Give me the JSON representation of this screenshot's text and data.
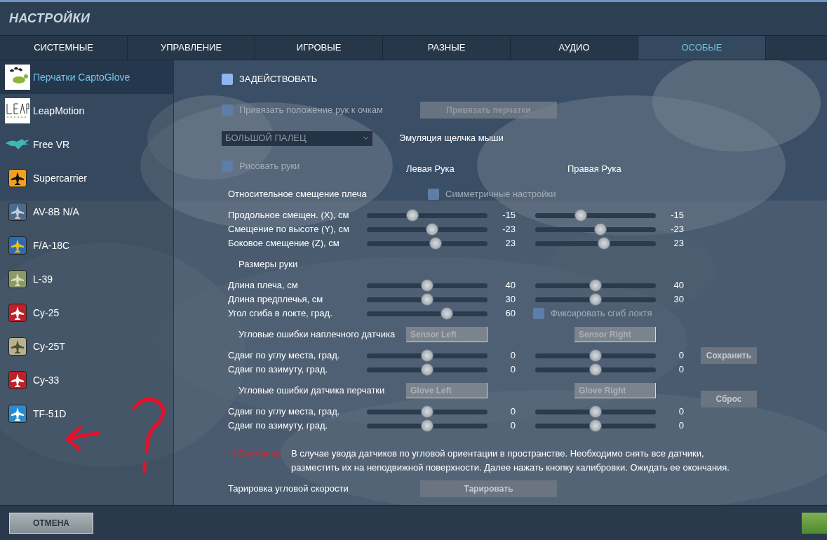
{
  "window": {
    "title": "НАСТРОЙКИ"
  },
  "tabs": [
    {
      "label": "СИСТЕМНЫЕ",
      "selected": false
    },
    {
      "label": "УПРАВЛЕНИЕ",
      "selected": false
    },
    {
      "label": "ИГРОВЫЕ",
      "selected": false
    },
    {
      "label": "РАЗНЫЕ",
      "selected": false
    },
    {
      "label": "АУДИО",
      "selected": false
    },
    {
      "label": "ОСОБЫЕ",
      "selected": true
    }
  ],
  "sidebar": {
    "items": [
      {
        "label": "Перчатки CaptoGlove",
        "selected": true
      },
      {
        "label": "LeapMotion",
        "selected": false
      },
      {
        "label": "Free VR",
        "selected": false
      },
      {
        "label": "Supercarrier",
        "selected": false
      },
      {
        "label": "AV-8B N/A",
        "selected": false
      },
      {
        "label": "F/A-18C",
        "selected": false
      },
      {
        "label": "L-39",
        "selected": false
      },
      {
        "label": "Су-25",
        "selected": false
      },
      {
        "label": "Су-25Т",
        "selected": false
      },
      {
        "label": "Су-33",
        "selected": false
      },
      {
        "label": "TF-51D",
        "selected": false
      }
    ]
  },
  "enable": {
    "label": "ЗАДЕЙСТВОВАТЬ",
    "checked": false,
    "disabled": false
  },
  "attach": {
    "label": "Привязать положение рук к очкам",
    "checked": false,
    "disabled": true,
    "button": "Привязать перчатки"
  },
  "finger": {
    "value": "БОЛЬШОЙ ПАЛЕЦ",
    "label": "Эмуляция щелчка мыши"
  },
  "draw_hands": {
    "label": "Рисовать руки",
    "checked": false,
    "disabled": true
  },
  "left_hand": "Левая Рука",
  "right_hand": "Правая Рука",
  "shoulder": {
    "label": "Относительное смещение плеча",
    "symmetric": {
      "label": "Симметричные настройки",
      "checked": false,
      "disabled": true
    }
  },
  "rows": [
    {
      "kind": "slider_pair",
      "label": "Продольное смещен. (X), см",
      "left": {
        "level": 0.38,
        "value": "-15"
      },
      "right": {
        "level": 0.38,
        "value": "-15"
      }
    },
    {
      "kind": "slider_pair",
      "label": "Смещение по высоте (Y), см",
      "left": {
        "level": 0.54,
        "value": "-23"
      },
      "right": {
        "level": 0.54,
        "value": "-23"
      }
    },
    {
      "kind": "slider_pair",
      "label": "Боковое смещение (Z), см",
      "left": {
        "level": 0.57,
        "value": "23"
      },
      "right": {
        "level": 0.57,
        "value": "23"
      }
    },
    {
      "kind": "heading",
      "label": "Размеры руки"
    },
    {
      "kind": "slider_pair",
      "label": "Длина плеча, см",
      "left": {
        "level": 0.5,
        "value": "40"
      },
      "right": {
        "level": 0.5,
        "value": "40"
      }
    },
    {
      "kind": "slider_pair",
      "label": "Длина предплечья, см",
      "left": {
        "level": 0.5,
        "value": "30"
      },
      "right": {
        "level": 0.5,
        "value": "30"
      }
    },
    {
      "kind": "slider_check",
      "label": "Угол сгиба в локте, град.",
      "left": {
        "level": 0.66,
        "value": "60"
      },
      "check": {
        "label": "Фиксировать сгиб локтя",
        "checked": false,
        "disabled": true
      }
    },
    {
      "kind": "sensor_buttons",
      "label": "Угловые ошибки наплечного датчика",
      "left_button": "Sensor Left",
      "right_button": "Sensor Right"
    },
    {
      "kind": "slider_pair",
      "label": "Сдвиг по углу места, град.",
      "left": {
        "level": 0.5,
        "value": "0"
      },
      "right": {
        "level": 0.5,
        "value": "0"
      },
      "side_button": "Сохранить"
    },
    {
      "kind": "slider_pair",
      "label": "Сдвиг по азимуту, град.",
      "left": {
        "level": 0.5,
        "value": "0"
      },
      "right": {
        "level": 0.5,
        "value": "0"
      }
    },
    {
      "kind": "sensor_buttons",
      "label": "Угловые ошибки датчика перчатки",
      "left_button": "Glove Left",
      "right_button": "Glove Right",
      "side_button": "Сброс"
    },
    {
      "kind": "slider_pair",
      "label": "Сдвиг по углу места, град.",
      "left": {
        "level": 0.5,
        "value": "0"
      },
      "right": {
        "level": 0.5,
        "value": "0"
      }
    },
    {
      "kind": "slider_pair",
      "label": "Сдвиг по азимуту, град.",
      "left": {
        "level": 0.5,
        "value": "0"
      },
      "right": {
        "level": 0.5,
        "value": "0"
      }
    }
  ],
  "warning": {
    "label": "!!! Внимание.",
    "text": "В случае увода датчиков по угловой ориентации в пространстве. Необходимо снять все датчики, разместить их на неподвижной поверхности. Далее нажать кнопку калибровки. Ожидать ее окончания."
  },
  "calibration": {
    "label": "Тарировка угловой скорости",
    "button": "Тарировать"
  },
  "footer": {
    "cancel": "ОТМЕНА"
  }
}
